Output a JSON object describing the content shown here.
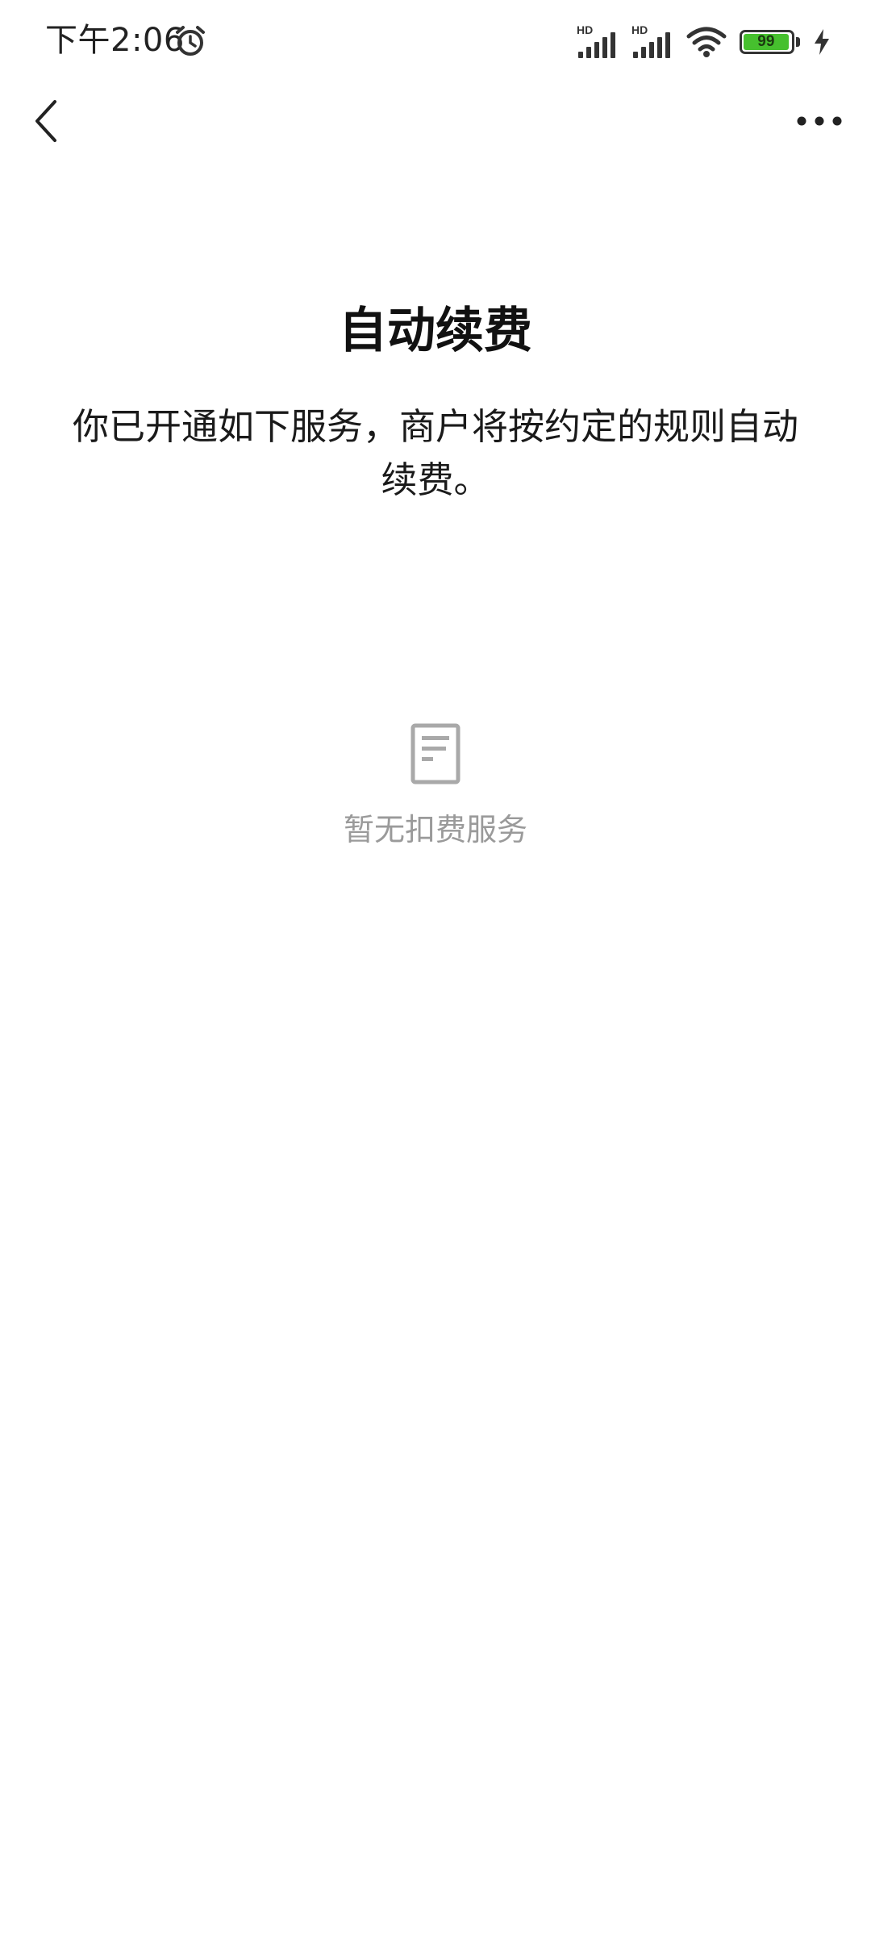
{
  "status_bar": {
    "time": "下午2:06",
    "alarm_icon": "alarm-clock-icon",
    "signal_1_label": "HD",
    "signal_2_label": "HD",
    "wifi_icon": "wifi-icon",
    "battery_level": "99",
    "battery_color": "#46c02e",
    "charging_icon": "lightning-bolt-icon"
  },
  "nav": {
    "back_icon": "chevron-left-icon",
    "more_icon": "more-dots-icon"
  },
  "page": {
    "title": "自动续费",
    "description": "你已开通如下服务，商户将按约定的规则自动续费。"
  },
  "empty_state": {
    "icon": "document-icon",
    "text": "暂无扣费服务"
  }
}
